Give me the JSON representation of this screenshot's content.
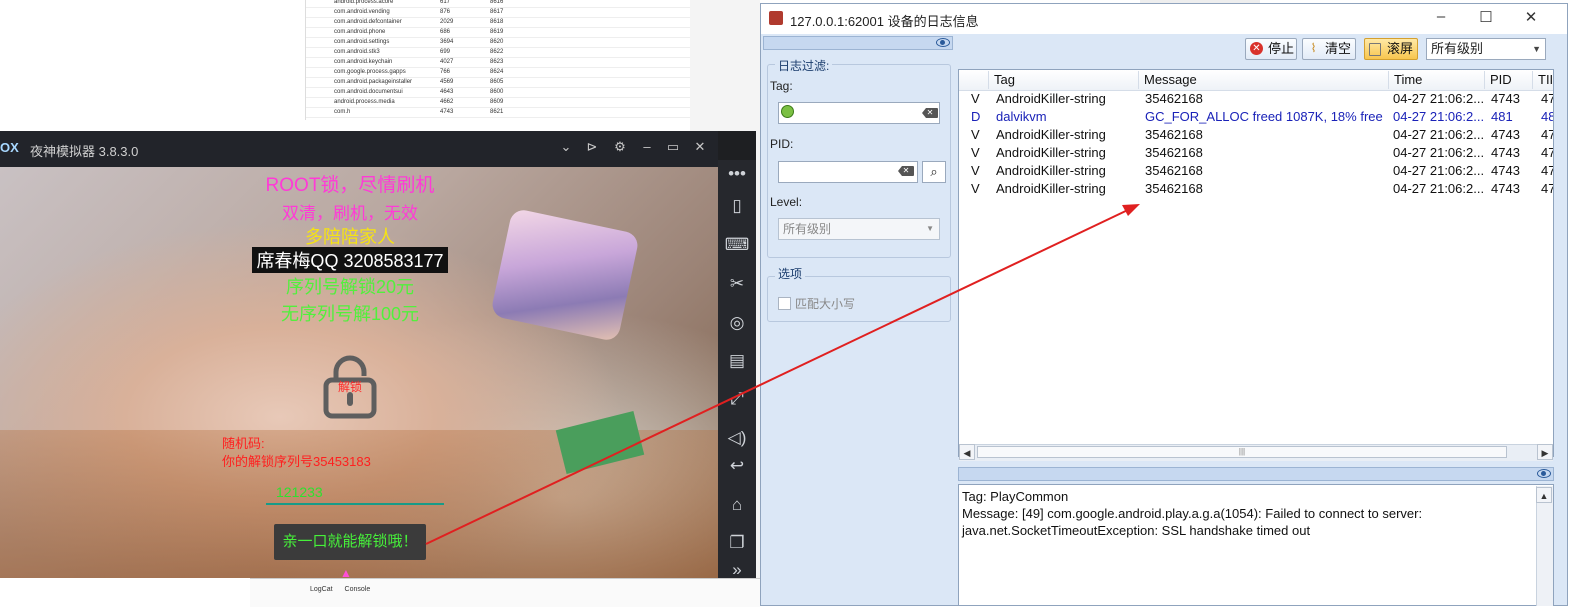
{
  "background_table": {
    "rows": [
      {
        "name": "android.process.acore",
        "pid": "617",
        "port": "8616"
      },
      {
        "name": "com.android.vending",
        "pid": "876",
        "port": "8617"
      },
      {
        "name": "com.android.defcontainer",
        "pid": "2029",
        "port": "8618"
      },
      {
        "name": "com.android.phone",
        "pid": "686",
        "port": "8619"
      },
      {
        "name": "com.android.settings",
        "pid": "3694",
        "port": "8620"
      },
      {
        "name": "com.android.stk3",
        "pid": "699",
        "port": "8622"
      },
      {
        "name": "com.android.keychain",
        "pid": "4027",
        "port": "8623"
      },
      {
        "name": "com.google.process.gapps",
        "pid": "766",
        "port": "8624"
      },
      {
        "name": "com.android.packageinstaller",
        "pid": "4569",
        "port": "8605"
      },
      {
        "name": "com.android.documentsui",
        "pid": "4643",
        "port": "8600"
      },
      {
        "name": "android.process.media",
        "pid": "4662",
        "port": "8609"
      },
      {
        "name": "com.h",
        "pid": "4743",
        "port": "8621"
      }
    ],
    "bottom_tabs": [
      "LogCat",
      "Console"
    ]
  },
  "emulator": {
    "logo": "OX",
    "title": "夜神模拟器 3.8.3.0",
    "window_icons": [
      "chevron-down-icon",
      "pin-icon",
      "gear-icon",
      "minimize-icon",
      "maximize-icon",
      "close-icon"
    ],
    "sidebar_icons": [
      "more-icon",
      "shake-icon",
      "keyboard-icon",
      "scissors-icon",
      "location-icon",
      "screen-icon",
      "fullscreen-icon",
      "volume-icon",
      "back-icon",
      "home-icon",
      "recent-apps-icon",
      "expand-icon"
    ],
    "ransom": {
      "line1": "ROOT锁，尽情刷机",
      "line2": "双清，刷机，无效",
      "line3": "多陪陪家人",
      "line4": "席春梅QQ 3208583177",
      "line5": "序列号解锁20元",
      "line6": "无序列号解100元",
      "lock_label": "解锁",
      "random_label": "随机码:",
      "serial_label": "你的解锁序列号35453183",
      "input_value": "121233",
      "unlock_button": "亲一口就能解锁哦！"
    }
  },
  "logwin": {
    "title": "127.0.0.1:62001 设备的日志信息",
    "toolbar": {
      "stop": "停止",
      "clear": "清空",
      "scroll": "滚屏",
      "level_value": "所有级别"
    },
    "filter": {
      "legend": "日志过滤:",
      "tag_label": "Tag:",
      "tag_value": "",
      "pid_label": "PID:",
      "pid_value": "",
      "level_label": "Level:",
      "level_value": "所有级别"
    },
    "options": {
      "legend": "选项",
      "match_case": "匹配大小写"
    },
    "columns": [
      "Tag",
      "Message",
      "Time",
      "PID",
      "TII"
    ],
    "rows": [
      {
        "level": "V",
        "tag": "AndroidKiller-string",
        "message": "35462168",
        "time": "04-27 21:06:2...",
        "pid": "4743",
        "tid": "47",
        "color": "#111111"
      },
      {
        "level": "D",
        "tag": "dalvikvm",
        "message": "GC_FOR_ALLOC freed 1087K, 18% free ...",
        "time": "04-27 21:06:2...",
        "pid": "481",
        "tid": "48",
        "color": "#1a22b8"
      },
      {
        "level": "V",
        "tag": "AndroidKiller-string",
        "message": "35462168",
        "time": "04-27 21:06:2...",
        "pid": "4743",
        "tid": "47",
        "color": "#111111"
      },
      {
        "level": "V",
        "tag": "AndroidKiller-string",
        "message": "35462168",
        "time": "04-27 21:06:2...",
        "pid": "4743",
        "tid": "47",
        "color": "#111111"
      },
      {
        "level": "V",
        "tag": "AndroidKiller-string",
        "message": "35462168",
        "time": "04-27 21:06:2...",
        "pid": "4743",
        "tid": "47",
        "color": "#111111"
      },
      {
        "level": "V",
        "tag": "AndroidKiller-string",
        "message": "35462168",
        "time": "04-27 21:06:2...",
        "pid": "4743",
        "tid": "47",
        "color": "#111111"
      }
    ],
    "detail": {
      "line1": "Tag: PlayCommon",
      "line2": "Message: [49] com.google.android.play.a.g.a(1054): Failed to connect to server:",
      "line3": "java.net.SocketTimeoutException: SSL handshake timed out"
    }
  },
  "colors": {
    "arrow": "#e02020",
    "magenta": "#ff3ad7",
    "green": "#52f03c",
    "yellow": "#f5e313",
    "panel": "#dbe7f6",
    "debug_blue": "#1a22b8"
  }
}
